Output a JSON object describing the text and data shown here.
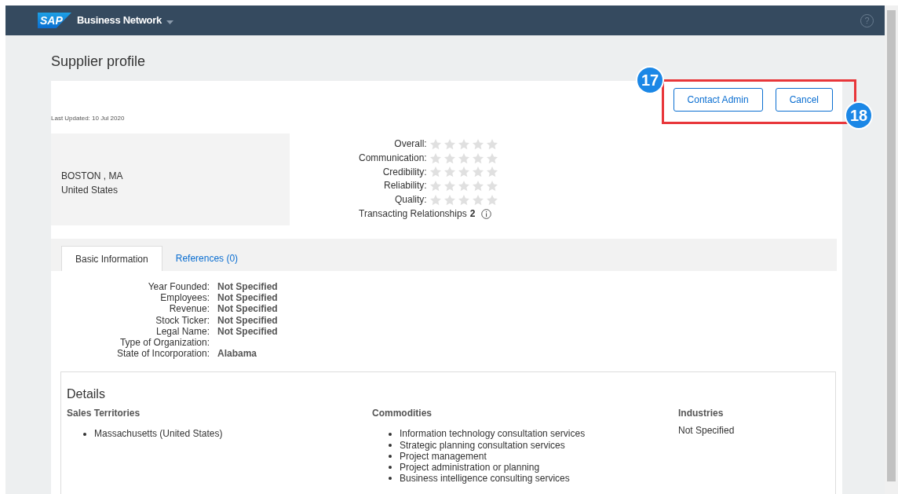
{
  "header": {
    "logo": "SAP",
    "app_name": "Business Network",
    "help": "?"
  },
  "page_title": "Supplier profile",
  "last_updated": "Last Updated: 10 Jul 2020",
  "actions": [
    {
      "label": "Contact Admin",
      "callout": "17"
    },
    {
      "label": "Cancel",
      "callout": "18"
    }
  ],
  "address": [
    "BOSTON , MA",
    "United States"
  ],
  "ratings": [
    {
      "label": "Overall:",
      "stars": 0
    },
    {
      "label": "Communication:",
      "stars": 0
    },
    {
      "label": "Credibility:",
      "stars": 0
    },
    {
      "label": "Reliability:",
      "stars": 0
    },
    {
      "label": "Quality:",
      "stars": 0
    }
  ],
  "relationships": {
    "label": "Transacting Relationships",
    "count": "2"
  },
  "tabs": [
    {
      "label": "Basic Information",
      "selected": true
    },
    {
      "label": "References (0)",
      "selected": false
    }
  ],
  "basic_info": [
    {
      "label": "Year Founded:",
      "value": "Not Specified"
    },
    {
      "label": "Employees:",
      "value": "Not Specified"
    },
    {
      "label": "Revenue:",
      "value": "Not Specified"
    },
    {
      "label": "Stock Ticker:",
      "value": "Not Specified"
    },
    {
      "label": "Legal Name:",
      "value": "Not Specified"
    },
    {
      "label": "Type of Organization:"
    },
    {
      "label": "State of Incorporation:",
      "value": "Alabama"
    }
  ],
  "details": {
    "title": "Details",
    "columns": [
      {
        "heading": "Sales Territories",
        "kind": "list",
        "items": [
          "Massachusetts (United States)"
        ]
      },
      {
        "heading": "Commodities",
        "kind": "list",
        "items": [
          "Information technology consultation services",
          "Strategic planning consultation services",
          "Project management",
          "Project administration or planning",
          "Business intelligence consulting services"
        ]
      },
      {
        "heading": "Industries",
        "kind": "text",
        "text": "Not Specified"
      }
    ]
  }
}
